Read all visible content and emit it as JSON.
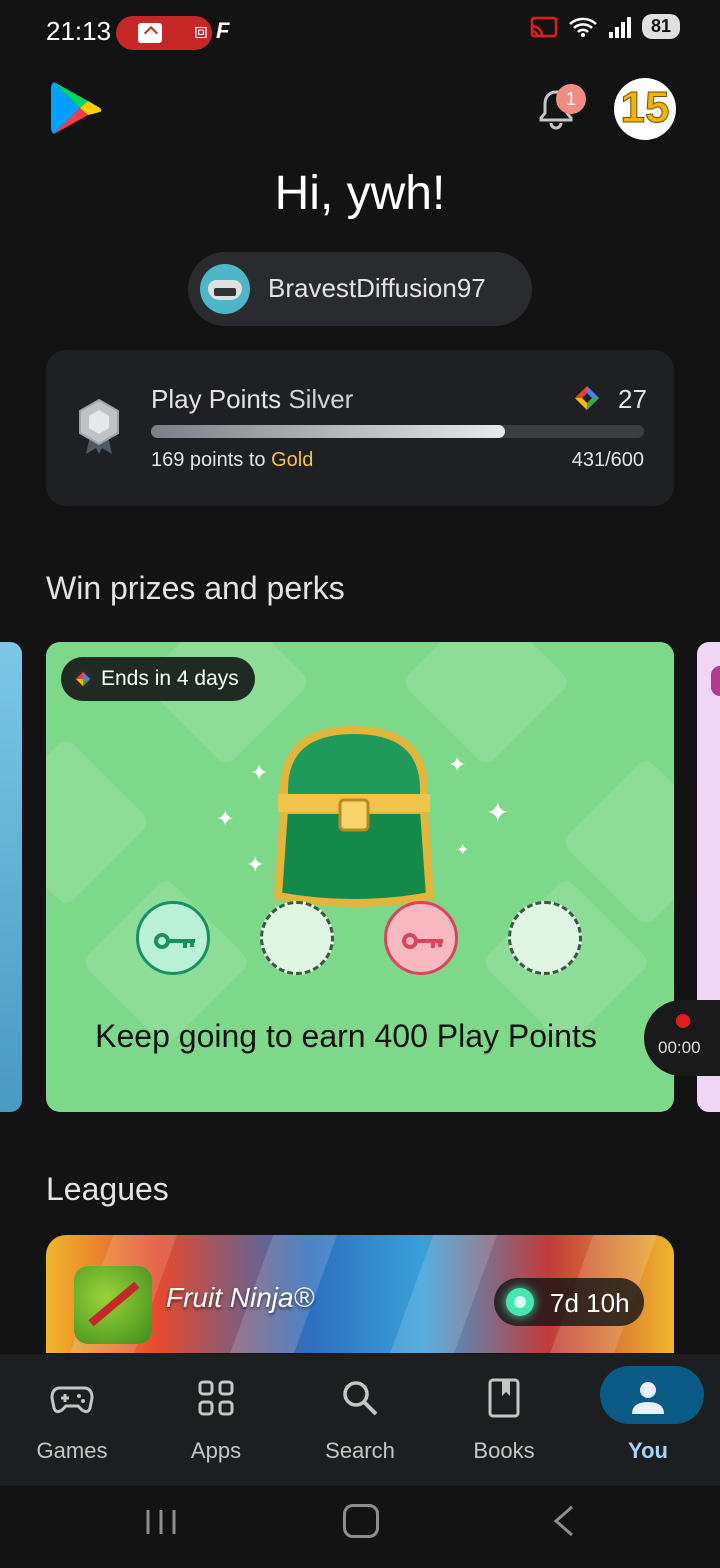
{
  "status_bar": {
    "time": "21:13",
    "left_icons": [
      "screen-record-icon",
      "scan-icon",
      "f-icon"
    ],
    "right_icons": [
      "cast-icon",
      "wifi-icon",
      "signal-icon"
    ],
    "battery": "81"
  },
  "header": {
    "logo": "google-play-logo",
    "notification_count": "1",
    "avatar_text": "15"
  },
  "greeting": "Hi, ywh!",
  "user_chip": {
    "gamer_name": "BravestDiffusion97"
  },
  "play_points": {
    "label": "Play Points",
    "tier": "Silver",
    "points_balance": "27",
    "progress_fraction": 0.7183,
    "points_to_next_prefix": "169 points to",
    "next_tier": "Gold",
    "progress_text": "431/600"
  },
  "prizes": {
    "section_title": "Win prizes and perks",
    "ends_label": "Ends in 4 days",
    "key_slots": [
      "collected-green",
      "empty",
      "collected-red",
      "empty"
    ],
    "message": "Keep going to earn 400 Play Points",
    "card_color": "#7ed88a"
  },
  "recording_overlay": {
    "time": "00:00"
  },
  "leagues": {
    "section_title": "Leagues",
    "game_title": "Fruit Ninja®",
    "time_left": "7d 10h"
  },
  "bottom_nav": {
    "items": [
      {
        "label": "Games",
        "icon": "gamepad-icon"
      },
      {
        "label": "Apps",
        "icon": "apps-grid-icon"
      },
      {
        "label": "Search",
        "icon": "search-icon"
      },
      {
        "label": "Books",
        "icon": "book-icon"
      },
      {
        "label": "You",
        "icon": "person-icon"
      }
    ],
    "active": "You",
    "accent": "#a8d3ff"
  }
}
